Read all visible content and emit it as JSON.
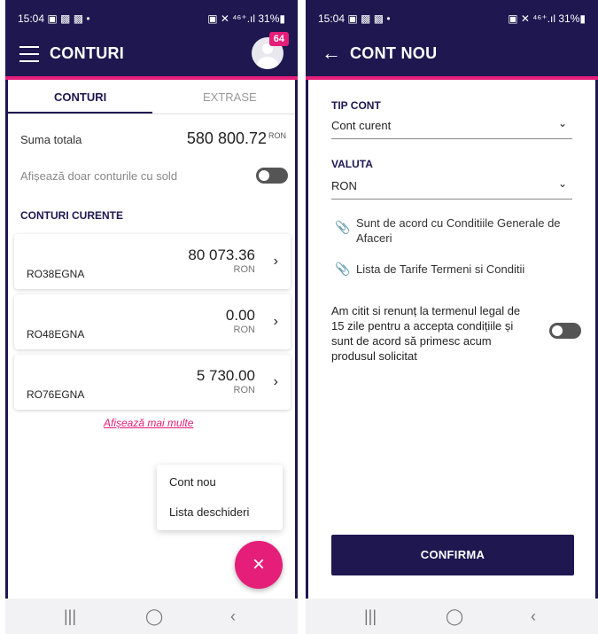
{
  "left": {
    "status": {
      "time": "15:04 ▣ ▩ ▩ •",
      "right": "▣ ✕ ⁴⁶⁺.ıl 31%▮"
    },
    "appbar": {
      "title": "CONTURI",
      "badge": "64"
    },
    "tabs": [
      {
        "label": "CONTURI"
      },
      {
        "label": "EXTRASE"
      }
    ],
    "total": {
      "label": "Suma totala",
      "value": "580 800.72",
      "currency": "RON"
    },
    "filter": {
      "label": "Afișează doar conturile cu sold"
    },
    "section": "CONTURI CURENTE",
    "accounts": [
      {
        "amount": "80 073.36",
        "currency": "RON",
        "iban": "RO38EGNA"
      },
      {
        "amount": "0.00",
        "currency": "RON",
        "iban": "RO48EGNA"
      },
      {
        "amount": "5 730.00",
        "currency": "RON",
        "iban": "RO76EGNA"
      }
    ],
    "more_link": "Afișează mai multe",
    "menu": [
      {
        "label": "Cont nou"
      },
      {
        "label": "Lista deschideri"
      }
    ],
    "fab_icon": "×"
  },
  "right": {
    "status": {
      "time": "15:04 ▣ ▩ ▩ •",
      "right": "▣ ✕ ⁴⁶⁺.ıl 31%▮"
    },
    "appbar": {
      "title": "CONT NOU"
    },
    "tip_cont": {
      "label": "TIP CONT",
      "value": "Cont curent"
    },
    "valuta": {
      "label": "VALUTA",
      "value": "RON"
    },
    "docs": [
      {
        "text": "Sunt de acord cu Conditiile Generale de Afaceri"
      },
      {
        "text": "Lista de Tarife Termeni si Conditii"
      }
    ],
    "consent": "Am citit si renunț la termenul legal de 15 zile pentru a accepta condițiile și sunt de acord să primesc acum produsul solicitat",
    "confirm": "CONFIRMA"
  },
  "nav": {
    "recents": "|||",
    "home": "◯",
    "back": "‹"
  },
  "colors": {
    "primary": "#1e1750",
    "accent": "#e41e79"
  }
}
